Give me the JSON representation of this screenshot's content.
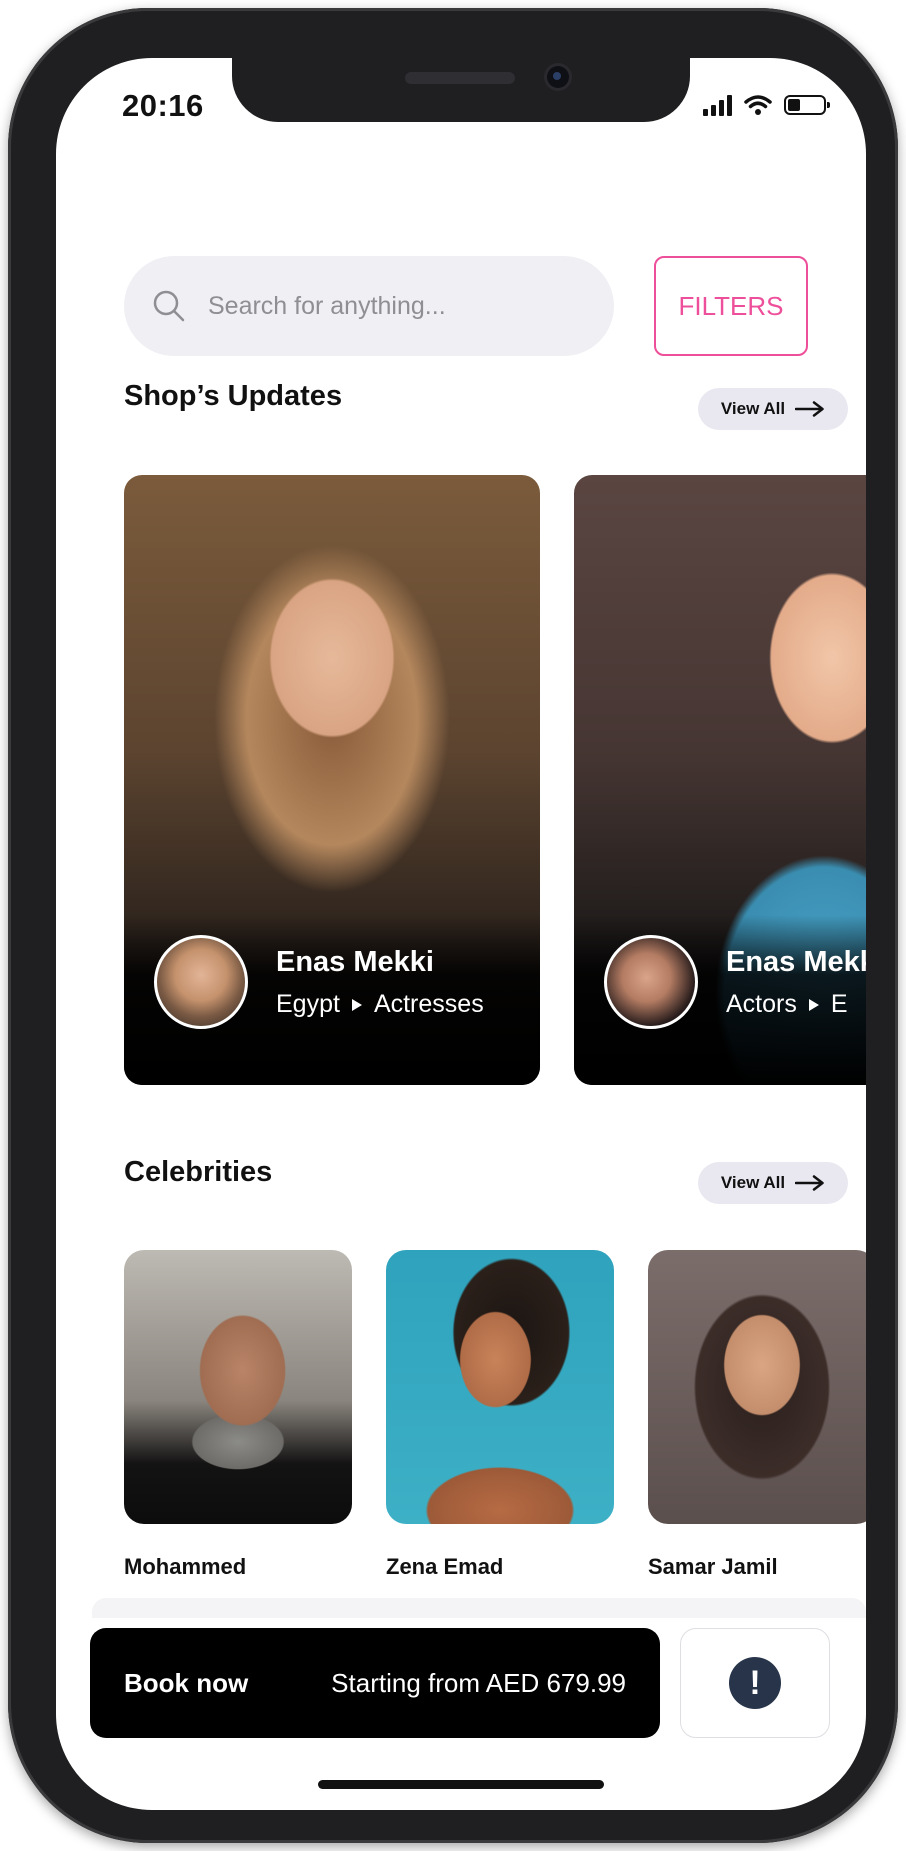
{
  "status_bar": {
    "time": "20:16"
  },
  "search": {
    "placeholder": "Search for anything..."
  },
  "filters_label": "FILTERS",
  "shop_updates": {
    "title": "Shop’s Updates",
    "view_all": "View All",
    "cards": [
      {
        "name": "Enas Mekki",
        "meta_left": "Egypt",
        "meta_right": "Actresses"
      },
      {
        "name": "Enas Mekki",
        "meta_left": "Actors",
        "meta_right": "E"
      }
    ]
  },
  "celebrities": {
    "title": "Celebrities",
    "view_all": "View All",
    "items": [
      {
        "name": "Mohammed"
      },
      {
        "name": "Zena Emad"
      },
      {
        "name": "Samar Jamil"
      }
    ]
  },
  "booking": {
    "label": "Book now",
    "price_text": "Starting from AED 679.99",
    "info_icon": "!"
  },
  "colors": {
    "accent": "#ee4f9a",
    "info": "#27344a"
  }
}
